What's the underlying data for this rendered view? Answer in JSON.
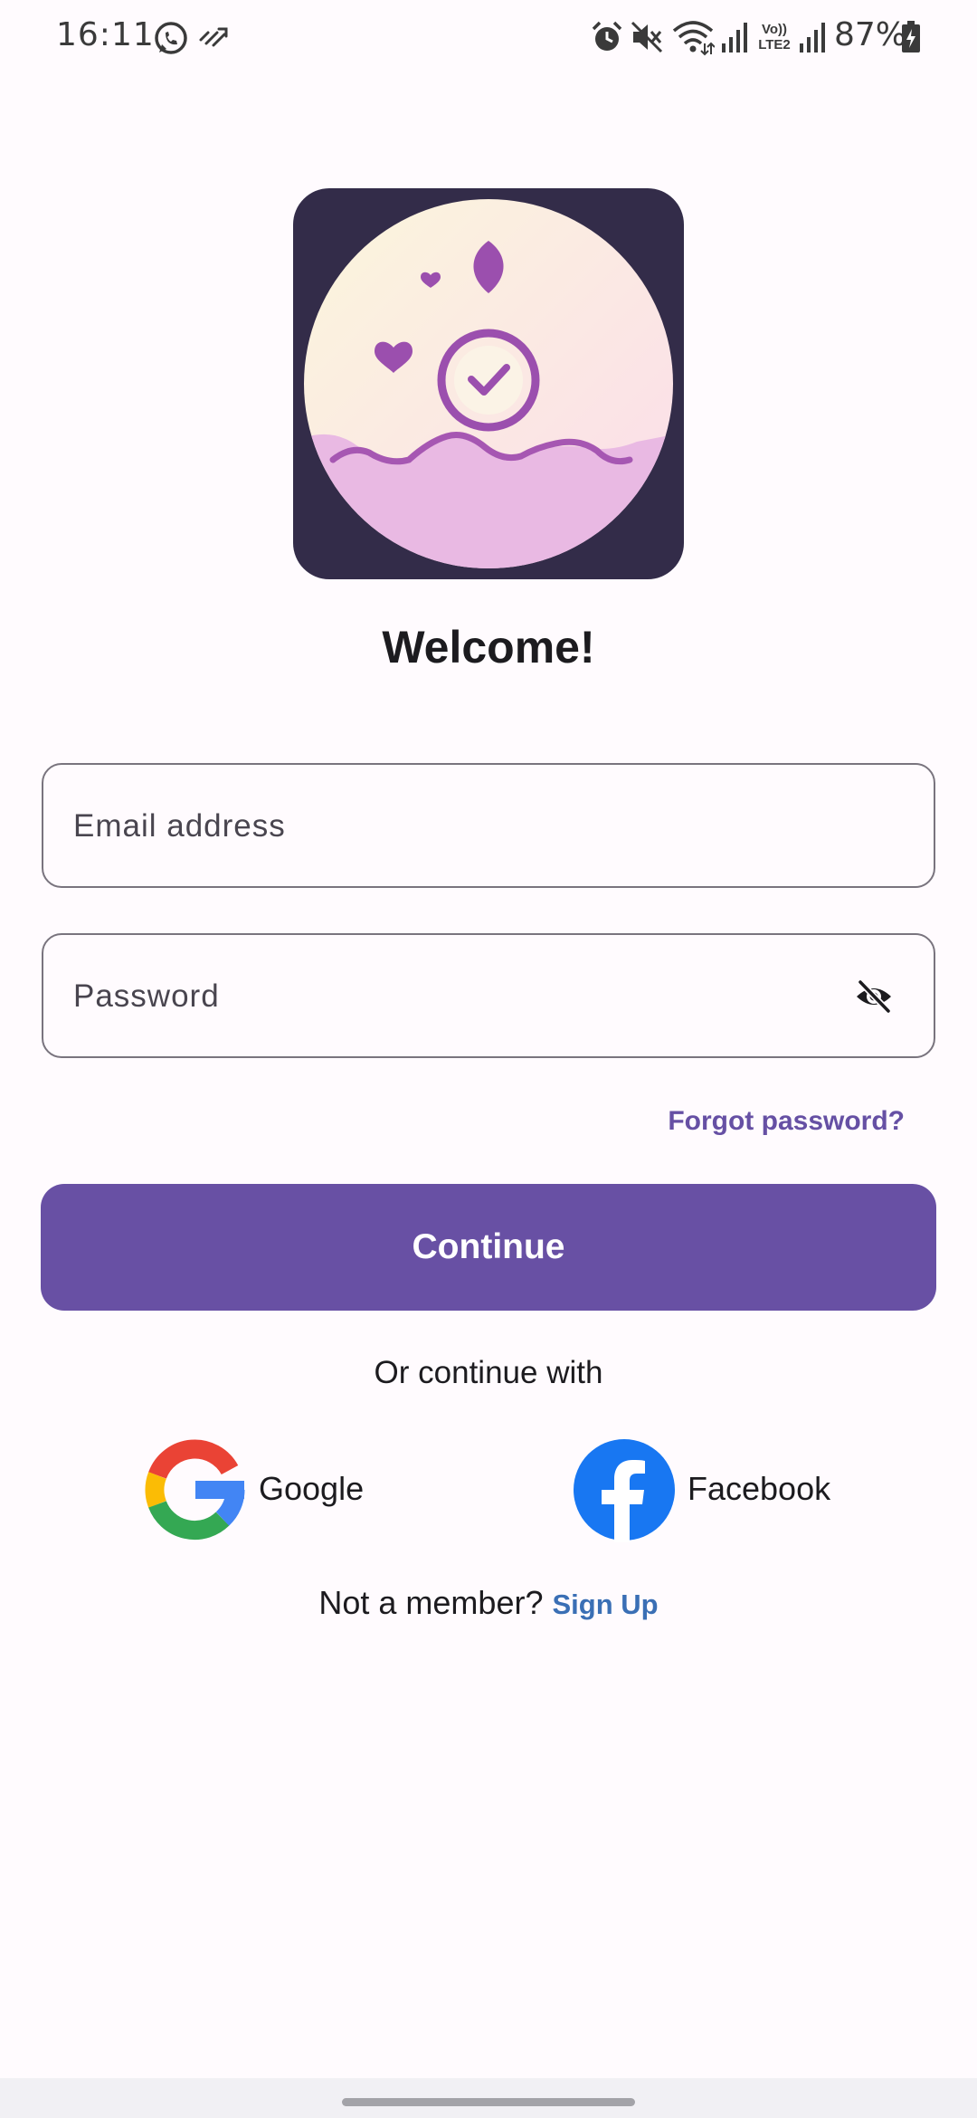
{
  "status_bar": {
    "time": "16:11",
    "battery": "87%",
    "network_label": "Vo)) LTE2",
    "icons": [
      "whatsapp-icon",
      "missed-call-icon",
      "alarm-icon",
      "mute-icon",
      "wifi-icon",
      "signal-icon",
      "volte-icon",
      "battery-icon"
    ]
  },
  "welcome_title": "Welcome!",
  "email": {
    "placeholder": "Email address",
    "value": ""
  },
  "password": {
    "placeholder": "Password",
    "value": "",
    "toggle_icon": "visibility-off-icon"
  },
  "forgot_password": "Forgot password?",
  "continue_label": "Continue",
  "or_continue_with": "Or continue with",
  "social": {
    "google": "Google",
    "facebook": "Facebook"
  },
  "signup": {
    "prompt": "Not a member?",
    "link": "Sign Up"
  },
  "colors": {
    "primary": "#6850a4",
    "link": "#3a6fb5",
    "background": "#fffbfe",
    "logo_background": "#332c49"
  }
}
